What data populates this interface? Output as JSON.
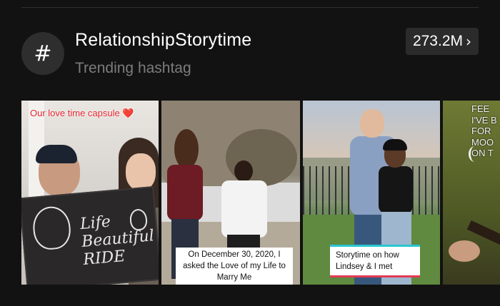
{
  "hashtag": {
    "symbol": "#",
    "title": "RelationshipStorytime",
    "subtitle": "Trending hashtag",
    "count_label": "273.2M",
    "chevron": "›"
  },
  "videos": [
    {
      "caption": "Our love time capsule",
      "emoji": "❤️",
      "board_text": "Life Beautiful RIDE"
    },
    {
      "caption": "On December 30, 2020, I asked the Love of my Life to Marry Me"
    },
    {
      "caption": "Storytime on how Lindsey & I met"
    },
    {
      "caption": "FEE\nI'VE B\nFOR\nMOO\nON T"
    }
  ],
  "colors": {
    "background": "#121212",
    "badge_bg": "#2b2b2b",
    "muted_text": "#7c7c7c",
    "caption_red": "#e3222b"
  }
}
